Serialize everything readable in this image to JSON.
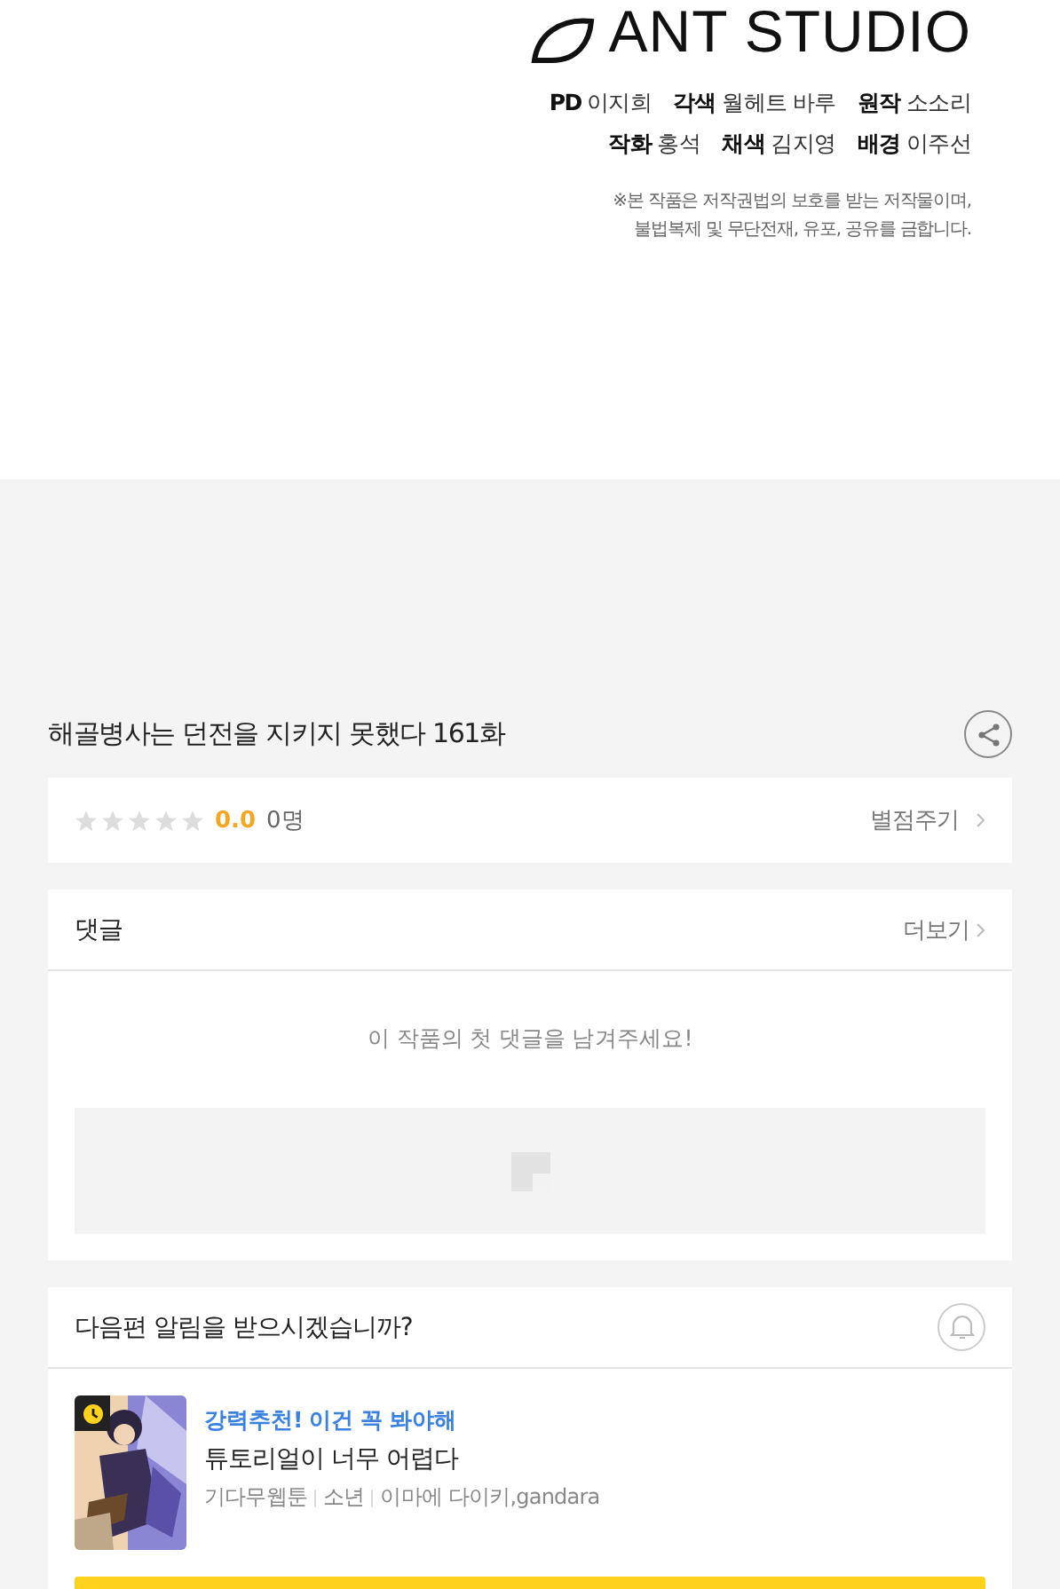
{
  "credits": {
    "studio": "ANT STUDIO",
    "lines": [
      [
        {
          "role": "PD",
          "name": "이지희"
        },
        {
          "role": "각색",
          "name": "월헤트 바루"
        },
        {
          "role": "원작",
          "name": "소소리"
        }
      ],
      [
        {
          "role": "작화",
          "name": "홍석"
        },
        {
          "role": "채색",
          "name": "김지영"
        },
        {
          "role": "배경",
          "name": "이주선"
        }
      ]
    ],
    "notice": [
      "※본 작품은 저작권법의 보호를 받는 저작물이며,",
      "불법복제 및 무단전재, 유포, 공유를 금합니다."
    ]
  },
  "episode_title": "해골병사는 던전을 지키지 못했다 161화",
  "rating": {
    "stars": 0,
    "score": "0.0",
    "count": "0명",
    "action": "별점주기"
  },
  "comments": {
    "title": "댓글",
    "more": "더보기",
    "empty": "이 작품의 첫 댓글을 남겨주세요!"
  },
  "notify": {
    "question": "다음편 알림을 받으시겠습니까?",
    "subscribed": false,
    "recommendation": {
      "tagline": "강력추천! 이건 꼭 봐야해",
      "title": "튜토리얼이 너무 어렵다",
      "meta": [
        "기다무웹툰",
        "소년",
        "이마에 다이키,gandara"
      ],
      "wait_free": true
    }
  }
}
